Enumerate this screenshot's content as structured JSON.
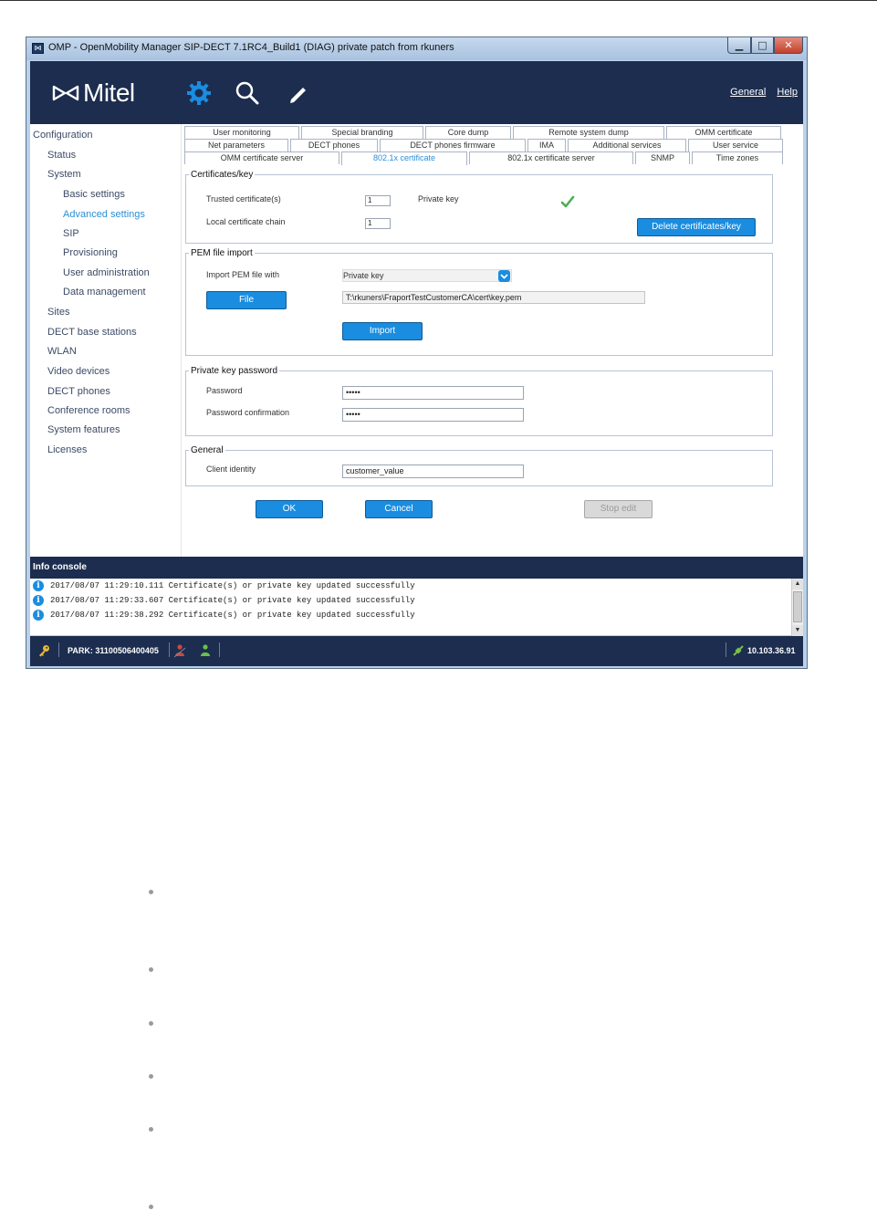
{
  "window": {
    "title": "OMP - OpenMobility Manager SIP-DECT 7.1RC4_Build1 (DIAG) private patch from rkuners",
    "app_icon_glyph": "⋈",
    "min_glyph": "▁",
    "max_glyph": "□",
    "close_glyph": "✕"
  },
  "header": {
    "brand": "Mitel",
    "links": [
      "General",
      "Help"
    ]
  },
  "nav": {
    "items": [
      {
        "label": "Configuration",
        "level": 0
      },
      {
        "label": "Status",
        "level": 1
      },
      {
        "label": "System",
        "level": 1
      },
      {
        "label": "Basic settings",
        "level": 2
      },
      {
        "label": "Advanced settings",
        "level": 2,
        "active": true
      },
      {
        "label": "SIP",
        "level": 2
      },
      {
        "label": "Provisioning",
        "level": 2
      },
      {
        "label": "User administration",
        "level": 2
      },
      {
        "label": "Data management",
        "level": 2
      },
      {
        "label": "Sites",
        "level": 1
      },
      {
        "label": "DECT base stations",
        "level": 1
      },
      {
        "label": "WLAN",
        "level": 1
      },
      {
        "label": "Video devices",
        "level": 1
      },
      {
        "label": "DECT phones",
        "level": 1
      },
      {
        "label": "Conference rooms",
        "level": 1
      },
      {
        "label": "System features",
        "level": 1
      },
      {
        "label": "Licenses",
        "level": 1
      }
    ]
  },
  "tabs": {
    "row1": [
      "User monitoring",
      "Special branding",
      "Core dump",
      "Remote system dump",
      "OMM certificate"
    ],
    "row2": [
      "Net parameters",
      "DECT phones",
      "DECT phones firmware",
      "IMA",
      "Additional services",
      "User service"
    ],
    "row3": [
      "OMM certificate server",
      "802.1x certificate",
      "802.1x certificate server",
      "SNMP",
      "Time zones"
    ],
    "active": "802.1x certificate"
  },
  "certs": {
    "legend": "Certificates/key",
    "trusted_label": "Trusted certificate(s)",
    "trusted_value": "1",
    "chain_label": "Local certificate chain",
    "chain_value": "1",
    "private_key_label": "Private key",
    "delete_button": "Delete certificates/key",
    "check_color": "#4caf50"
  },
  "pem": {
    "legend": "PEM file import",
    "import_label": "Import PEM file with",
    "select_value": "Private key",
    "file_button": "File",
    "file_path": "T:\\rkuners\\FraportTestCustomerCA\\cert\\key.pem",
    "import_button": "Import"
  },
  "password": {
    "legend": "Private key password",
    "password_label": "Password",
    "password_value": "•••••",
    "confirm_label": "Password confirmation",
    "confirm_value": "•••••"
  },
  "general": {
    "legend": "General",
    "identity_label": "Client identity",
    "identity_value": "customer_value"
  },
  "actions": {
    "ok": "OK",
    "cancel": "Cancel",
    "stop_edit": "Stop edit"
  },
  "console": {
    "title": "Info console",
    "info_glyph": "i",
    "up_glyph": "▲",
    "down_glyph": "▼",
    "logs": [
      "2017/08/07 11:29:10.111 Certificate(s) or private key updated successfully",
      "2017/08/07 11:29:33.607 Certificate(s) or private key updated successfully",
      "2017/08/07 11:29:38.292 Certificate(s) or private key updated successfully"
    ]
  },
  "status": {
    "park": "PARK: 31100506400405",
    "ip": "10.103.36.91"
  },
  "colors": {
    "header_bg": "#1c2d4f",
    "accent": "#1a8de0",
    "active_tab": "#2a8fd6"
  }
}
